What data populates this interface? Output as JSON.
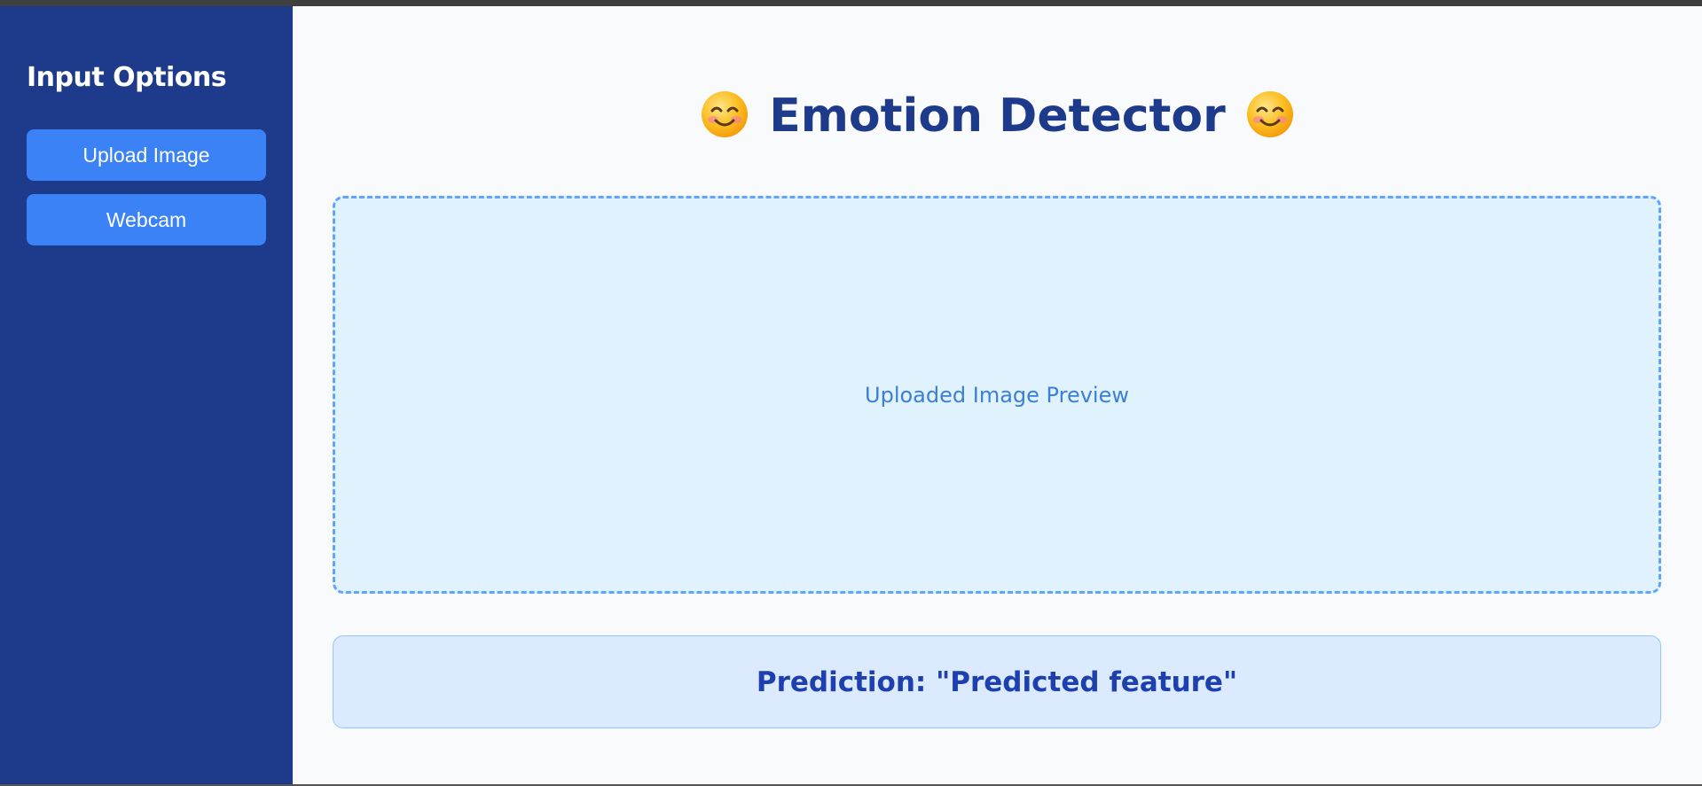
{
  "sidebar": {
    "title": "Input Options",
    "buttons": [
      {
        "label": "Upload Image"
      },
      {
        "label": "Webcam"
      }
    ]
  },
  "main": {
    "title": "Emotion Detector",
    "title_icons": [
      "smiling-face-emoji",
      "smiling-face-emoji"
    ],
    "preview_placeholder": "Uploaded Image Preview",
    "prediction_label": "Prediction: \"Predicted feature\""
  },
  "colors": {
    "sidebar_bg": "#1e3a8a",
    "button_bg": "#3b82f6",
    "title_color": "#1e3a8a",
    "preview_bg": "#e0f2fe",
    "preview_border": "#60a5fa",
    "prediction_bg": "#dbeafe",
    "prediction_text": "#1e40af"
  }
}
